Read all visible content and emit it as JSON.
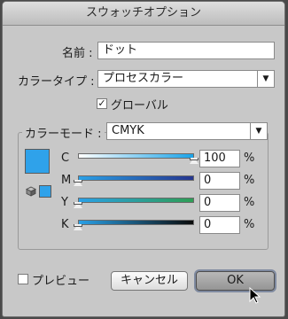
{
  "window": {
    "title": "スウォッチオプション"
  },
  "name_field": {
    "label": "名前 :",
    "value": "ドット"
  },
  "color_type": {
    "label": "カラータイプ :",
    "value": "プロセスカラー"
  },
  "global": {
    "checked": true,
    "check_glyph": "✓",
    "label": "グローバル"
  },
  "color_mode": {
    "label": "カラーモード :",
    "value": "CMYK"
  },
  "swatch_color": "#2fa2ea",
  "sliders": [
    {
      "label": "C",
      "value": "100",
      "percent": 100,
      "unit": "%",
      "gradient": [
        "#ffffff",
        "#1aa3e8"
      ]
    },
    {
      "label": "M",
      "value": "0",
      "percent": 0,
      "unit": "%",
      "gradient": [
        "#2aa0e6",
        "#26368f"
      ]
    },
    {
      "label": "Y",
      "value": "0",
      "percent": 0,
      "unit": "%",
      "gradient": [
        "#2aa0e6",
        "#2e9e55"
      ]
    },
    {
      "label": "K",
      "value": "0",
      "percent": 0,
      "unit": "%",
      "gradient": [
        "#2aa0e6",
        "#0a0a0a"
      ]
    }
  ],
  "preview": {
    "checked": false,
    "label": "プレビュー"
  },
  "buttons": {
    "cancel": "キャンセル",
    "ok": "OK"
  }
}
